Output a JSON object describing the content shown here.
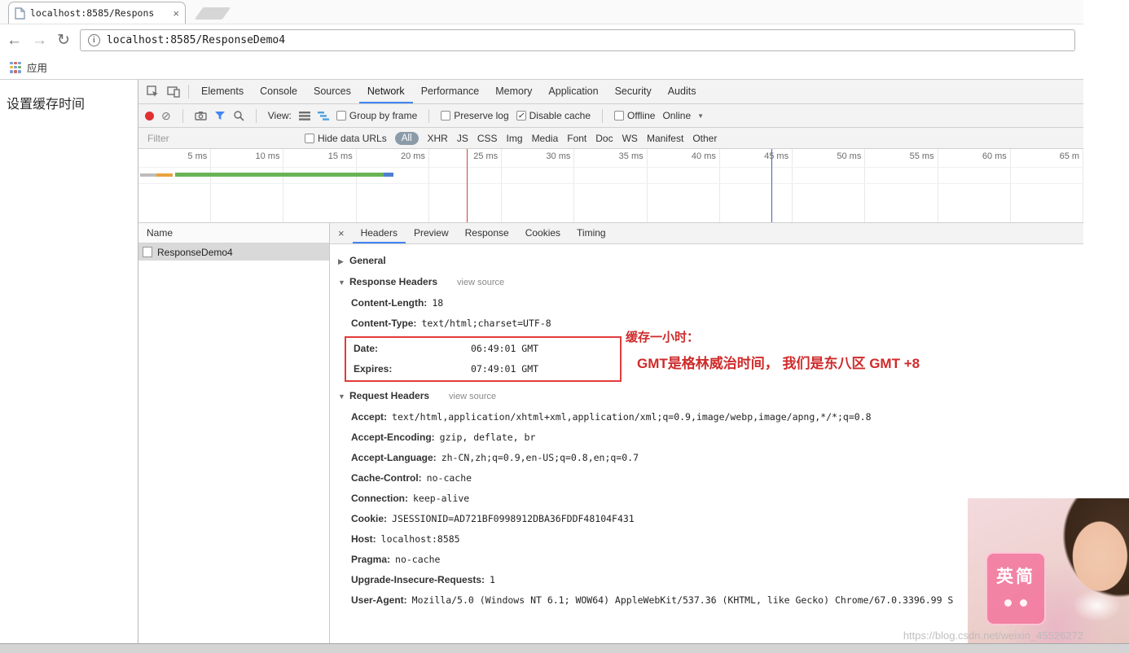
{
  "icons": {
    "back": "←",
    "forward": "→",
    "reload": "↻",
    "info": "i",
    "tab_close": "×",
    "detail_close": "×",
    "block": "⊘",
    "dropdown_arrow": "▼",
    "expanded_arrow": "▼",
    "collapsed_arrow": "▶",
    "check": "✓"
  },
  "colors": {
    "accent_blue": "#4285f4",
    "annotation_red": "#cf2b2b",
    "record_red": "#e03131",
    "selected_row": "#d9d9d9",
    "load_line_red": "#d04437",
    "dcl_line_blue": "#3f5fbf"
  },
  "browser": {
    "tab": {
      "title": "localhost:8585/Respons"
    },
    "nav": {
      "url": "localhost:8585/ResponseDemo4"
    },
    "bookmarks_bar": {
      "apps_label": "应用"
    }
  },
  "page": {
    "heading": "设置缓存时间"
  },
  "devtools": {
    "tabs": [
      "Elements",
      "Console",
      "Sources",
      "Network",
      "Performance",
      "Memory",
      "Application",
      "Security",
      "Audits"
    ],
    "toolbar": {
      "view_label": "View:",
      "checkboxes": [
        "Group by frame",
        "Preserve log",
        "Disable cache",
        "Offline"
      ],
      "online_label": "Online"
    },
    "filter": {
      "placeholder": "Filter",
      "hide_data_urls_label": "Hide data URLs",
      "types": [
        "All",
        "XHR",
        "JS",
        "CSS",
        "Img",
        "Media",
        "Font",
        "Doc",
        "WS",
        "Manifest",
        "Other"
      ]
    },
    "timeline_ticks": [
      "5 ms",
      "10 ms",
      "15 ms",
      "20 ms",
      "25 ms",
      "30 ms",
      "35 ms",
      "40 ms",
      "45 ms",
      "50 ms",
      "55 ms",
      "60 ms",
      "65 m"
    ],
    "requests": {
      "name_header": "Name",
      "rows": [
        "ResponseDemo4"
      ]
    },
    "detail_tabs": [
      "Headers",
      "Preview",
      "Response",
      "Cookies",
      "Timing"
    ],
    "headers_pane": {
      "general_label": "General",
      "response_label": "Response Headers",
      "request_label": "Request Headers",
      "view_source_label": "view source",
      "response_headers": [
        {
          "name": "Content-Length:",
          "value": "18"
        },
        {
          "name": "Content-Type:",
          "value": "text/html;charset=UTF-8"
        }
      ],
      "boxed_headers": [
        {
          "name": "Date:",
          "value": "06:49:01 GMT"
        },
        {
          "name": "Expires:",
          "value": "07:49:01 GMT"
        }
      ],
      "request_headers": [
        {
          "name": "Accept:",
          "value": "text/html,application/xhtml+xml,application/xml;q=0.9,image/webp,image/apng,*/*;q=0.8"
        },
        {
          "name": "Accept-Encoding:",
          "value": "gzip, deflate, br"
        },
        {
          "name": "Accept-Language:",
          "value": "zh-CN,zh;q=0.9,en-US;q=0.8,en;q=0.7"
        },
        {
          "name": "Cache-Control:",
          "value": "no-cache"
        },
        {
          "name": "Connection:",
          "value": "keep-alive"
        },
        {
          "name": "Cookie:",
          "value": "JSESSIONID=AD721BF0998912DBA36FDDF48104F431"
        },
        {
          "name": "Host:",
          "value": "localhost:8585"
        },
        {
          "name": "Pragma:",
          "value": "no-cache"
        },
        {
          "name": "Upgrade-Insecure-Requests:",
          "value": "1"
        },
        {
          "name": "User-Agent:",
          "value": "Mozilla/5.0 (Windows NT 6.1; WOW64) AppleWebKit/537.36 (KHTML, like Gecko) Chrome/67.0.3396.99 S"
        }
      ]
    },
    "annotation": {
      "line1": "缓存一小时：",
      "line2": "GMT是格林威治时间， 我们是东八区  GMT +8"
    }
  },
  "watermark": {
    "badge": "英简",
    "url": "https://blog.csdn.net/weixin_45526272"
  }
}
